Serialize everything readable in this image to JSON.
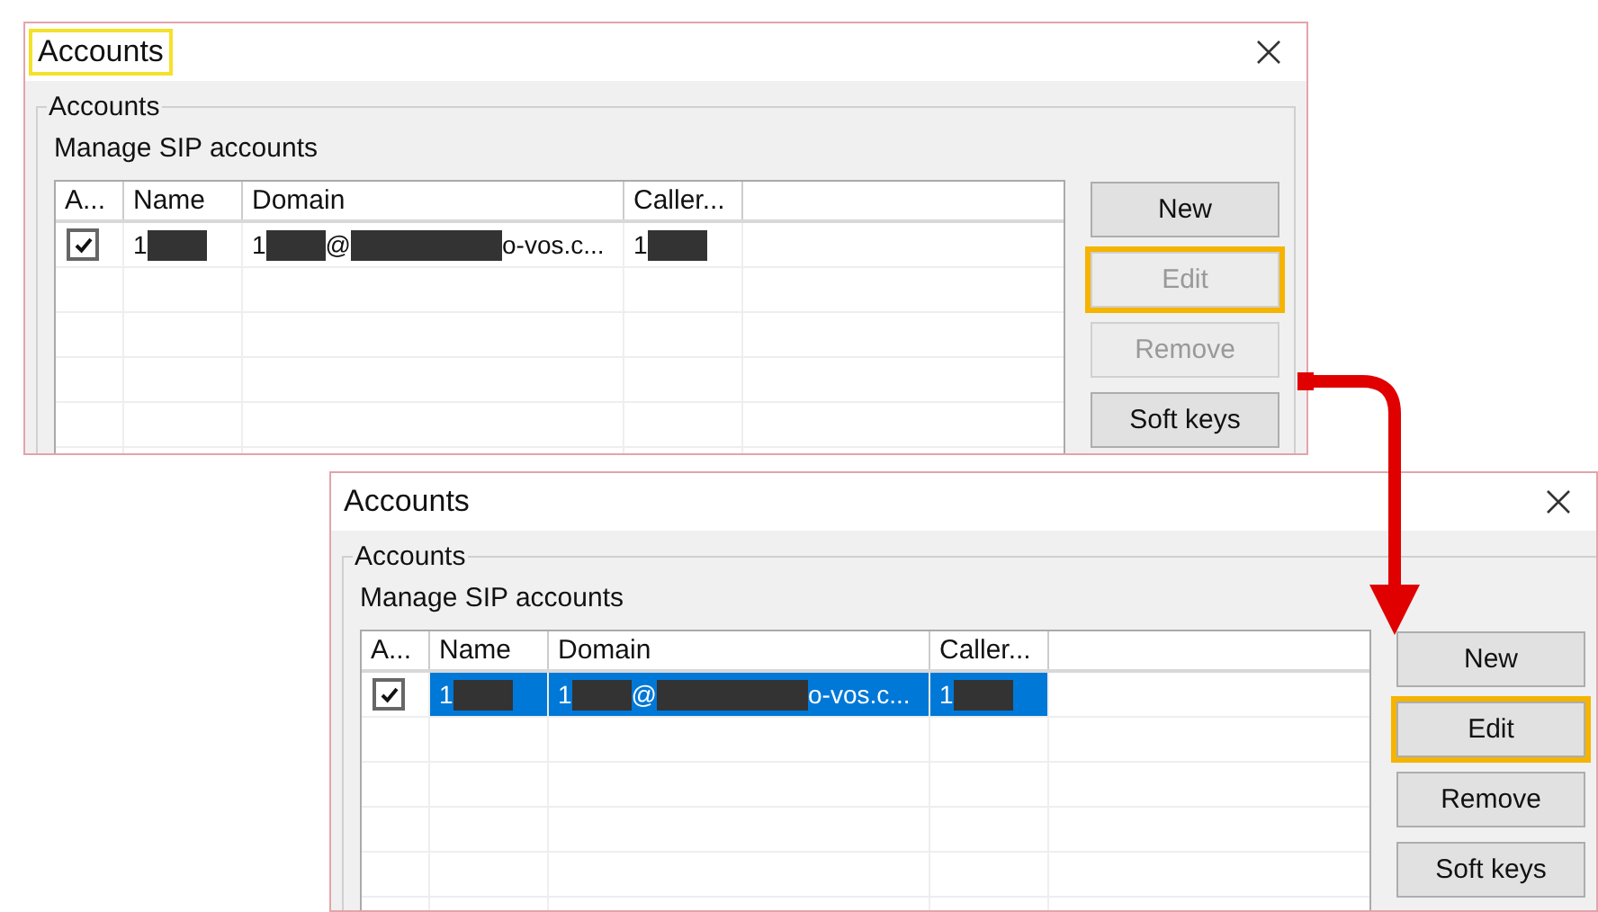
{
  "windows": [
    {
      "title": "Accounts",
      "title_highlighted": true,
      "group_label": "Accounts",
      "caption": "Manage SIP accounts",
      "columns": [
        "A...",
        "Name",
        "Domain",
        "Caller..."
      ],
      "rows": [
        {
          "selected": false,
          "cells": [
            {
              "kind": "checkbox",
              "checked": true
            },
            {
              "kind": "text",
              "parts": [
                {
                  "kind": "text",
                  "text": "1"
                },
                {
                  "kind": "redaction"
                }
              ]
            },
            {
              "kind": "text",
              "parts": [
                {
                  "kind": "text",
                  "text": "1"
                },
                {
                  "kind": "redaction"
                },
                {
                  "kind": "text",
                  "text": "@"
                },
                {
                  "kind": "long_redaction"
                },
                {
                  "kind": "text",
                  "text": "o-vos.c..."
                }
              ]
            },
            {
              "kind": "text",
              "parts": [
                {
                  "kind": "text",
                  "text": "1"
                },
                {
                  "kind": "redaction"
                }
              ]
            }
          ]
        }
      ],
      "buttons": [
        {
          "label": "New",
          "disabled": false,
          "highlighted": false
        },
        {
          "label": "Edit",
          "disabled": true,
          "highlighted": true
        },
        {
          "label": "Remove",
          "disabled": true,
          "highlighted": false
        },
        {
          "label": "Soft keys",
          "disabled": false,
          "highlighted": false
        }
      ]
    },
    {
      "title": "Accounts",
      "title_highlighted": false,
      "group_label": "Accounts",
      "caption": "Manage SIP accounts",
      "columns": [
        "A...",
        "Name",
        "Domain",
        "Caller..."
      ],
      "rows": [
        {
          "selected": true,
          "cells": [
            {
              "kind": "checkbox",
              "checked": true
            },
            {
              "kind": "text",
              "parts": [
                {
                  "kind": "text",
                  "text": "1"
                },
                {
                  "kind": "redaction"
                }
              ]
            },
            {
              "kind": "text",
              "parts": [
                {
                  "kind": "text",
                  "text": "1"
                },
                {
                  "kind": "redaction"
                },
                {
                  "kind": "text",
                  "text": "@"
                },
                {
                  "kind": "long_redaction"
                },
                {
                  "kind": "text",
                  "text": "o-vos.c..."
                }
              ]
            },
            {
              "kind": "text",
              "parts": [
                {
                  "kind": "text",
                  "text": "1"
                },
                {
                  "kind": "redaction"
                }
              ]
            }
          ]
        }
      ],
      "buttons": [
        {
          "label": "New",
          "disabled": false,
          "highlighted": false
        },
        {
          "label": "Edit",
          "disabled": false,
          "highlighted": true
        },
        {
          "label": "Remove",
          "disabled": false,
          "highlighted": false
        },
        {
          "label": "Soft keys",
          "disabled": false,
          "highlighted": false
        }
      ]
    }
  ]
}
